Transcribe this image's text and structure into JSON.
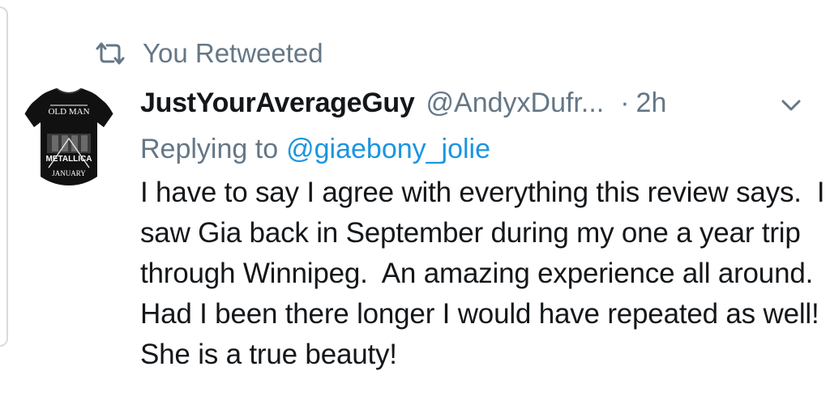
{
  "retweet": {
    "label": "You Retweeted",
    "icon": "retweet-icon"
  },
  "author": {
    "display_name": "JustYourAverageGuy",
    "handle": "@AndyxDufr...",
    "separator": "·",
    "time": "2h",
    "avatar": {
      "icon": "avatar-image",
      "text_lines": [
        "OLD MAN",
        "METALLICA",
        "JANUARY"
      ]
    }
  },
  "reply": {
    "prefix": "Replying to",
    "handle": "@giaebony_jolie"
  },
  "tweet": {
    "body": "I have to say I agree with everything this review says.  I saw Gia back in September during my one a year trip through Winnipeg.  An amazing experience all around.  Had I been there longer I would have repeated as well!  She is a true beauty!"
  },
  "menu": {
    "icon": "chevron-down-icon"
  },
  "colors": {
    "primary_text": "#14171a",
    "secondary_text": "#657786",
    "link": "#1b95e0",
    "border": "#d6dbdf"
  }
}
